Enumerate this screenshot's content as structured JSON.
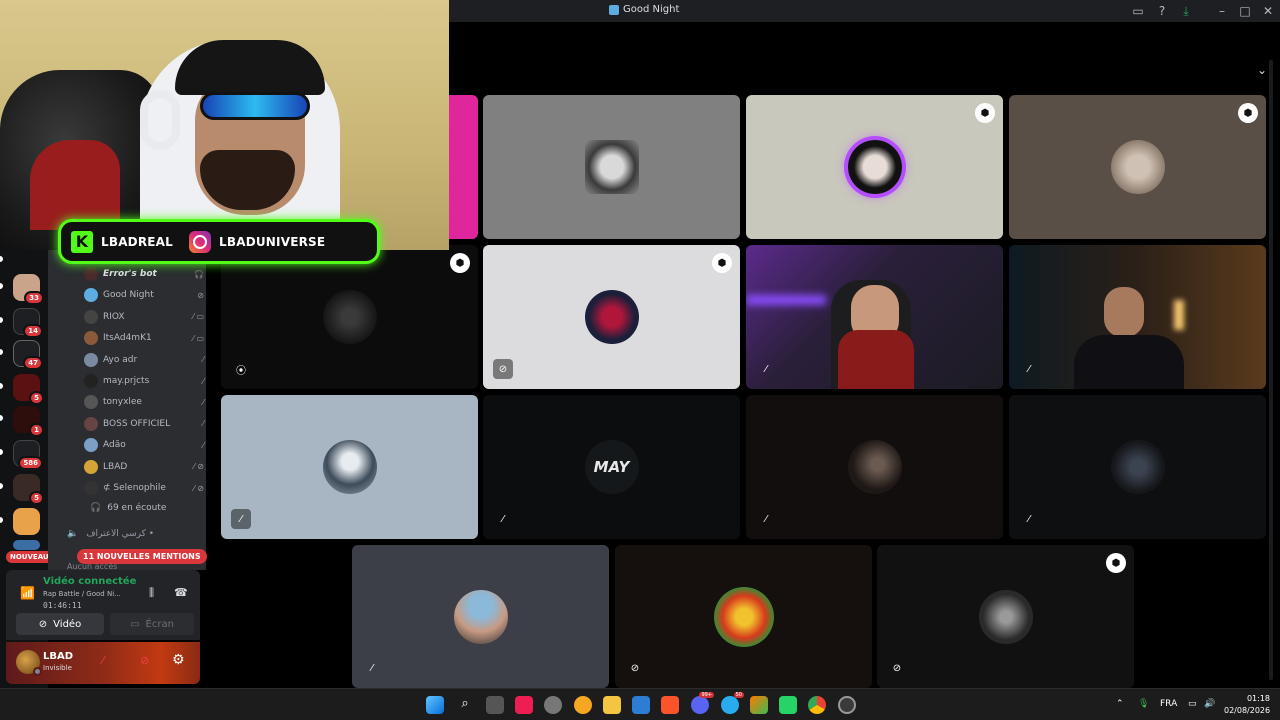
{
  "window": {
    "title": "Good Night",
    "controls": [
      "minimize",
      "maximize",
      "close"
    ]
  },
  "stream_overlay": {
    "kick_handle": "LBADREAL",
    "instagram_handle": "LBADUNIVERSE"
  },
  "server_rail": {
    "badges": [
      "33",
      "14",
      "47",
      "5",
      "1",
      "586",
      "5"
    ],
    "new_label": "NOUVEAU"
  },
  "channel": {
    "members": [
      {
        "name": "Error's bot",
        "icons": "🎧"
      },
      {
        "name": "Good Night",
        "icons": "⊘"
      },
      {
        "name": "RIOX",
        "icons": "⁄ ▭"
      },
      {
        "name": "ItsAd4mK1",
        "icons": "⁄ ▭"
      },
      {
        "name": "Ayo adr",
        "icons": "⁄"
      },
      {
        "name": "may.prjcts",
        "icons": "⁄"
      },
      {
        "name": "tonyxlee",
        "icons": "⁄"
      },
      {
        "name": "BOSS OFFICIEL",
        "icons": "⁄"
      },
      {
        "name": "Adão",
        "icons": "⁄"
      },
      {
        "name": "LBAD",
        "icons": "⁄ ⊘"
      },
      {
        "name": "⊄ Selenophile",
        "icons": "⁄ ⊘"
      }
    ],
    "listeners": "69 en écoute",
    "second_channel": "كرسي الاعتراف •",
    "mentions": "11 NOUVELLES MENTIONS",
    "no_access": "Aucun accès"
  },
  "voice_panel": {
    "status": "Vidéo connectée",
    "channel": "Rap Battle / Good Ni...",
    "elapsed": "01:46:11",
    "video_label": "Vidéo",
    "screen_label": "Écran"
  },
  "user_panel": {
    "name": "LBAD",
    "state": "Invisible"
  },
  "tiles": [
    {
      "id": "pink-edge",
      "bg": "#e0269c"
    },
    {
      "id": "gray-art",
      "bg": "#808080",
      "mic": ""
    },
    {
      "id": "beige-purple",
      "bg": "#c9c8bc",
      "shield": true
    },
    {
      "id": "brown-cat",
      "bg": "#5a4f47",
      "shield": true
    },
    {
      "id": "dark-1",
      "bg": "#0c0c0d",
      "shield": true,
      "mic": "⦿"
    },
    {
      "id": "lightgray-w",
      "bg": "#dcdcdf",
      "shield": true,
      "mic": "⊘"
    },
    {
      "id": "streamer-cam",
      "bg": "#2a1f3a",
      "mic": "⁄"
    },
    {
      "id": "room-cam",
      "bg": "#1b1410",
      "mic": "⁄"
    },
    {
      "id": "blue-astro",
      "bg": "#a7b6c2",
      "mic": "⁄"
    },
    {
      "id": "may-logo",
      "bg": "#0b0d0e",
      "mic": "⁄"
    },
    {
      "id": "dark-face",
      "bg": "#120e0d",
      "mic": "⁄"
    },
    {
      "id": "dark-mask",
      "bg": "#0e0f10",
      "mic": "⁄"
    },
    {
      "id": "slate-boy",
      "bg": "#3c3f47",
      "mic": "⁄"
    },
    {
      "id": "green-emblem",
      "bg": "#15100d",
      "mic": "⊘"
    },
    {
      "id": "dark-bw",
      "bg": "#111112",
      "shield": true,
      "mic": "⊘"
    }
  ],
  "may_logo_text": "MAY",
  "taskbar": {
    "tray": [
      "FRA"
    ],
    "time": "01:18",
    "date": "02/08/2026",
    "badges": [
      "99+",
      "50"
    ]
  },
  "colors": {
    "kick_green": "#53fc18",
    "danger": "#da373c",
    "online": "#23a55a"
  }
}
